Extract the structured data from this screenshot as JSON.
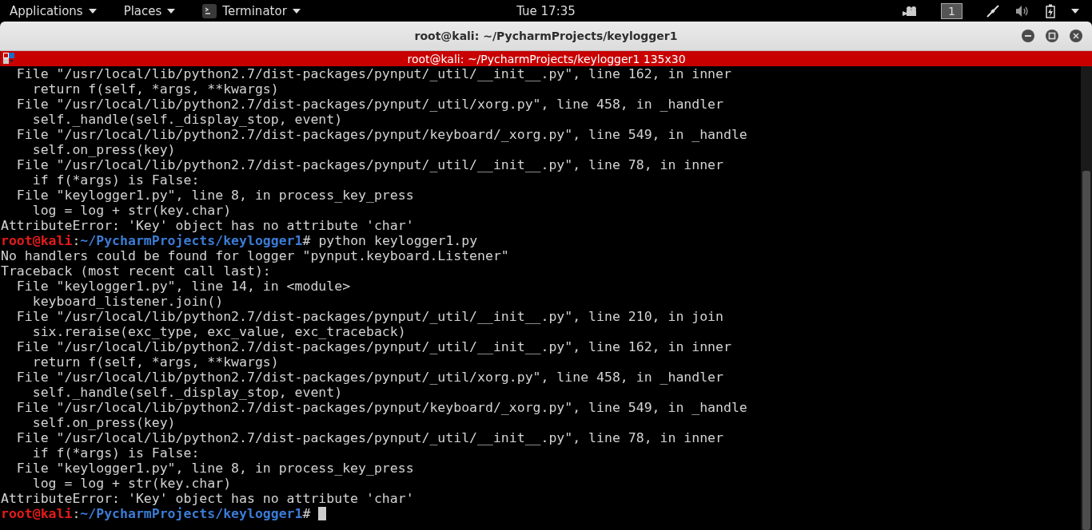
{
  "top_bar": {
    "menus": [
      {
        "label": "Applications",
        "kind": "menu"
      },
      {
        "label": "Places",
        "kind": "menu"
      },
      {
        "label": "Terminator",
        "kind": "app"
      }
    ],
    "clock": "Tue 17:35",
    "workspace": "1"
  },
  "window": {
    "title": "root@kali: ~/PycharmProjects/keylogger1"
  },
  "terminal": {
    "title": "root@kali: ~/PycharmProjects/keylogger1 135x30",
    "lines": [
      {
        "kind": "output",
        "text": "  File \"/usr/local/lib/python2.7/dist-packages/pynput/_util/__init__.py\", line 162, in inner"
      },
      {
        "kind": "output",
        "text": "    return f(self, *args, **kwargs)"
      },
      {
        "kind": "output",
        "text": "  File \"/usr/local/lib/python2.7/dist-packages/pynput/_util/xorg.py\", line 458, in _handler"
      },
      {
        "kind": "output",
        "text": "    self._handle(self._display_stop, event)"
      },
      {
        "kind": "output",
        "text": "  File \"/usr/local/lib/python2.7/dist-packages/pynput/keyboard/_xorg.py\", line 549, in _handle"
      },
      {
        "kind": "output",
        "text": "    self.on_press(key)"
      },
      {
        "kind": "output",
        "text": "  File \"/usr/local/lib/python2.7/dist-packages/pynput/_util/__init__.py\", line 78, in inner"
      },
      {
        "kind": "output",
        "text": "    if f(*args) is False:"
      },
      {
        "kind": "output",
        "text": "  File \"keylogger1.py\", line 8, in process_key_press"
      },
      {
        "kind": "output",
        "text": "    log = log + str(key.char)"
      },
      {
        "kind": "output",
        "text": "AttributeError: 'Key' object has no attribute 'char'"
      },
      {
        "kind": "prompt",
        "user_host": "root@kali",
        "separator": ":",
        "path": "~/PycharmProjects/keylogger1",
        "symbol": "#",
        "command": "python keylogger1.py"
      },
      {
        "kind": "output",
        "text": "No handlers could be found for logger \"pynput.keyboard.Listener\""
      },
      {
        "kind": "output",
        "text": "Traceback (most recent call last):"
      },
      {
        "kind": "output",
        "text": "  File \"keylogger1.py\", line 14, in <module>"
      },
      {
        "kind": "output",
        "text": "    keyboard_listener.join()"
      },
      {
        "kind": "output",
        "text": "  File \"/usr/local/lib/python2.7/dist-packages/pynput/_util/__init__.py\", line 210, in join"
      },
      {
        "kind": "output",
        "text": "    six.reraise(exc_type, exc_value, exc_traceback)"
      },
      {
        "kind": "output",
        "text": "  File \"/usr/local/lib/python2.7/dist-packages/pynput/_util/__init__.py\", line 162, in inner"
      },
      {
        "kind": "output",
        "text": "    return f(self, *args, **kwargs)"
      },
      {
        "kind": "output",
        "text": "  File \"/usr/local/lib/python2.7/dist-packages/pynput/_util/xorg.py\", line 458, in _handler"
      },
      {
        "kind": "output",
        "text": "    self._handle(self._display_stop, event)"
      },
      {
        "kind": "output",
        "text": "  File \"/usr/local/lib/python2.7/dist-packages/pynput/keyboard/_xorg.py\", line 549, in _handle"
      },
      {
        "kind": "output",
        "text": "    self.on_press(key)"
      },
      {
        "kind": "output",
        "text": "  File \"/usr/local/lib/python2.7/dist-packages/pynput/_util/__init__.py\", line 78, in inner"
      },
      {
        "kind": "output",
        "text": "    if f(*args) is False:"
      },
      {
        "kind": "output",
        "text": "  File \"keylogger1.py\", line 8, in process_key_press"
      },
      {
        "kind": "output",
        "text": "    log = log + str(key.char)"
      },
      {
        "kind": "output",
        "text": "AttributeError: 'Key' object has no attribute 'char'"
      },
      {
        "kind": "prompt",
        "user_host": "root@kali",
        "separator": ":",
        "path": "~/PycharmProjects/keylogger1",
        "symbol": "#",
        "cursor": true
      }
    ]
  }
}
